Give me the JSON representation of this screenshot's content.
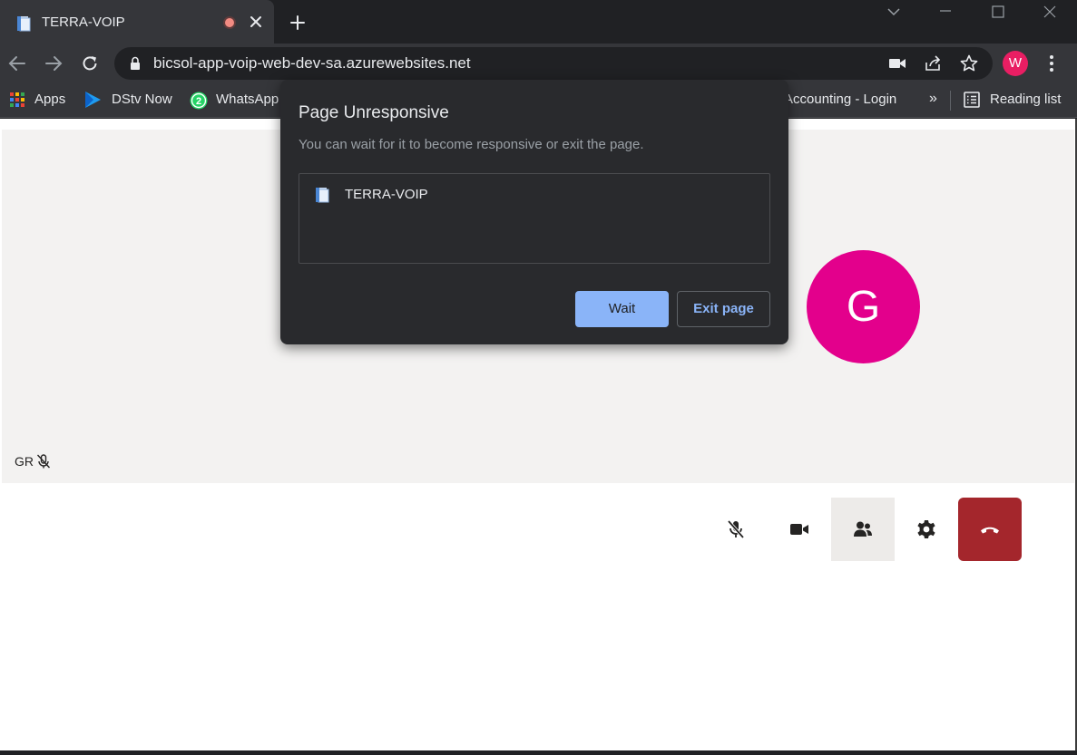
{
  "tab": {
    "title": "TERRA-VOIP",
    "favicon": "document-icon",
    "recording_color": "#f28b82"
  },
  "toolbar": {
    "url": "bicsol-app-voip-web-dev-sa.azurewebsites.net"
  },
  "profile": {
    "initial": "W",
    "color": "#e91e63"
  },
  "bookmarks": {
    "apps": "Apps",
    "dstv": "DStv Now",
    "whatsapp": "WhatsApp",
    "whatsapp_badge": "2",
    "accounting": "Accounting - Login",
    "more": "»",
    "reading_list": "Reading list"
  },
  "call": {
    "participant_label": "GR",
    "avatar_initial": "G",
    "avatar_color": "#e3008c",
    "hangup_color": "#a4262c"
  },
  "dialog": {
    "title": "Page Unresponsive",
    "message": "You can wait for it to become responsive or exit the page.",
    "item": "TERRA-VOIP",
    "wait_label": "Wait",
    "exit_label": "Exit page"
  }
}
